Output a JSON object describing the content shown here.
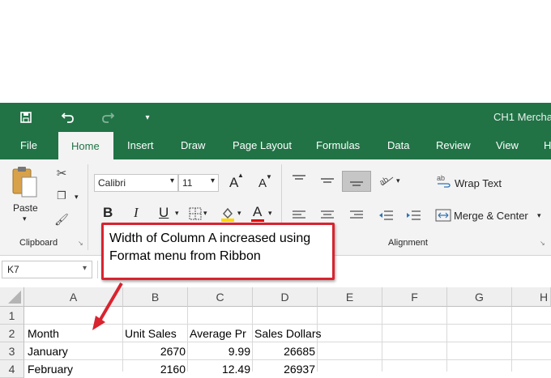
{
  "quick_access": {
    "save_icon": "save-icon",
    "undo_icon": "undo-icon",
    "redo_icon": "redo-icon",
    "customize_icon": "dropdown-icon"
  },
  "title_bar": {
    "doc_title": "CH1 Mercha"
  },
  "tabs": [
    {
      "label": "File"
    },
    {
      "label": "Home"
    },
    {
      "label": "Insert"
    },
    {
      "label": "Draw"
    },
    {
      "label": "Page Layout"
    },
    {
      "label": "Formulas"
    },
    {
      "label": "Data"
    },
    {
      "label": "Review"
    },
    {
      "label": "View"
    },
    {
      "label": "H"
    }
  ],
  "ribbon": {
    "clipboard": {
      "paste_label": "Paste",
      "group_label": "Clipboard"
    },
    "font": {
      "font_name": "Calibri",
      "font_size": "11",
      "grow": "A",
      "shrink": "A",
      "bold": "B",
      "italic": "I",
      "underline": "U",
      "font_color": "A"
    },
    "alignment": {
      "wrap_text": "Wrap Text",
      "merge_center": "Merge & Center",
      "group_label": "Alignment"
    }
  },
  "formula_bar": {
    "name_box": "K7"
  },
  "sheet": {
    "columns": [
      "A",
      "B",
      "C",
      "D",
      "E",
      "F",
      "G",
      "H"
    ],
    "rows": [
      "1",
      "2",
      "3",
      "4"
    ],
    "row2": [
      "Month",
      "Unit Sales",
      "Average Pr",
      "Sales Dollars"
    ],
    "row3": [
      "January",
      "2670",
      "9.99",
      "26685"
    ],
    "row4": [
      "February",
      "2160",
      "12.49",
      "26937"
    ]
  },
  "annotation": {
    "text": "Width of Column A increased using Format menu from Ribbon"
  },
  "colors": {
    "excel_green": "#217346",
    "callout_red": "#d9232f"
  }
}
